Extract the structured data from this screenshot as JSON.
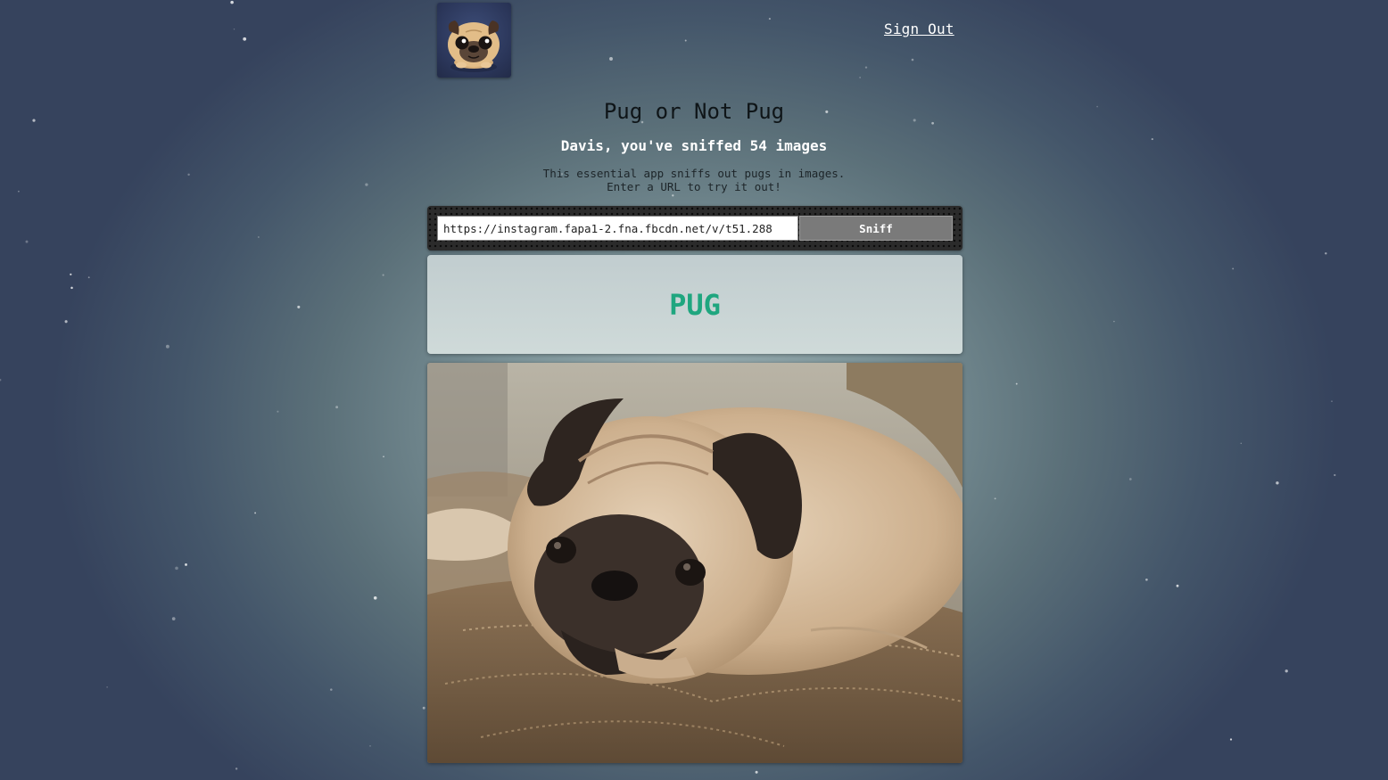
{
  "header": {
    "logo_icon": "pug-face-icon",
    "sign_out_label": "Sign Out"
  },
  "main": {
    "title": "Pug or Not Pug",
    "subtitle": "Davis, you've sniffed 54 images",
    "description_line1": "This essential app sniffs out pugs in images.",
    "description_line2": "Enter a URL to try it out!"
  },
  "form": {
    "url_value": "https://instagram.fapa1-2.fna.fbcdn.net/v/t51.288",
    "sniff_label": "Sniff"
  },
  "result": {
    "label": "PUG",
    "color": "#1fa67f"
  },
  "image": {
    "subject": "pug-photo"
  },
  "colors": {
    "background_center": "#9fb3b6",
    "background_edge": "#36435d",
    "button": "#7a7a7a"
  }
}
